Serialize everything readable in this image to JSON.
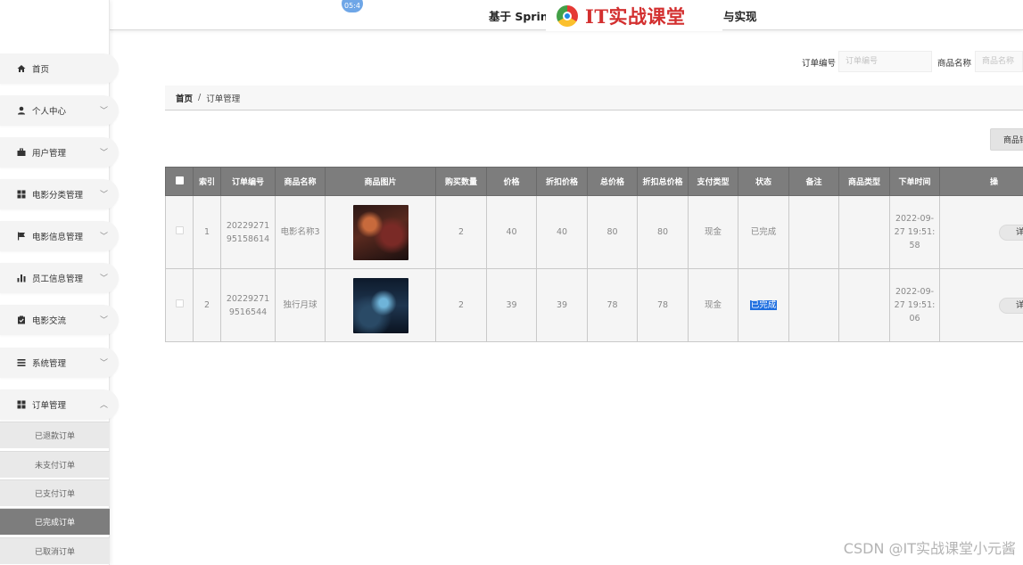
{
  "header": {
    "time_badge": "05:4",
    "title_left": "基于 Sprin",
    "title_right": "与实现",
    "logo_text": "IT实战课堂"
  },
  "sidebar": {
    "items": [
      {
        "label": "首页",
        "icon": "home-icon",
        "has_chevron": false
      },
      {
        "label": "个人中心",
        "icon": "user-icon",
        "has_chevron": true
      },
      {
        "label": "用户管理",
        "icon": "briefcase-icon",
        "has_chevron": true
      },
      {
        "label": "电影分类管理",
        "icon": "grid-icon",
        "has_chevron": true
      },
      {
        "label": "电影信息管理",
        "icon": "flag-icon",
        "has_chevron": true
      },
      {
        "label": "员工信息管理",
        "icon": "bar-chart-icon",
        "has_chevron": true
      },
      {
        "label": "电影交流",
        "icon": "clipboard-icon",
        "has_chevron": true
      },
      {
        "label": "系统管理",
        "icon": "list-icon",
        "has_chevron": true
      },
      {
        "label": "订单管理",
        "icon": "grid-icon",
        "has_chevron": true,
        "expanded": true
      }
    ],
    "sub_items": [
      {
        "label": "已退款订单",
        "active": false
      },
      {
        "label": "未支付订单",
        "active": false
      },
      {
        "label": "已支付订单",
        "active": false
      },
      {
        "label": "已完成订单",
        "active": true
      },
      {
        "label": "已取消订单",
        "active": false
      }
    ]
  },
  "search": {
    "order_no_label": "订单编号",
    "order_no_placeholder": "订单编号",
    "product_name_label": "商品名称",
    "product_name_placeholder": "商品名称"
  },
  "breadcrumb": {
    "home": "首页",
    "separator": "/",
    "current": "订单管理"
  },
  "toolbar": {
    "action_button_label": "商品销"
  },
  "table": {
    "headers": [
      "索引",
      "订单编号",
      "商品名称",
      "商品图片",
      "购买数量",
      "价格",
      "折扣价格",
      "总价格",
      "折扣总价格",
      "支付类型",
      "状态",
      "备注",
      "商品类型",
      "下单时间",
      "操"
    ],
    "rows": [
      {
        "index": "1",
        "order_no": "2022927195158614",
        "product_name": "电影名称3",
        "image": "poster-thumbnail-1",
        "quantity": "2",
        "price": "40",
        "discount_price": "40",
        "total": "80",
        "discount_total": "80",
        "pay_type": "现金",
        "status": "已完成",
        "remark": "",
        "product_type": "",
        "order_time": "2022-09-27 19:51:58",
        "action": "详情"
      },
      {
        "index": "2",
        "order_no": "202292719516544",
        "product_name": "独行月球",
        "image": "poster-thumbnail-2",
        "quantity": "2",
        "price": "39",
        "discount_price": "39",
        "total": "78",
        "discount_total": "78",
        "pay_type": "现金",
        "status": "已完成",
        "remark": "",
        "product_type": "",
        "order_time": "2022-09-27 19:51:06",
        "action": "详情"
      }
    ]
  },
  "watermark": {
    "csdn": "CSDN @IT实战课堂小元酱"
  },
  "colors": {
    "table_header_bg": "#7d7d7d",
    "active_sub_item_bg": "#7d7d7d",
    "logo_red": "#d32f2f",
    "selection_blue": "#1f6fe0"
  }
}
